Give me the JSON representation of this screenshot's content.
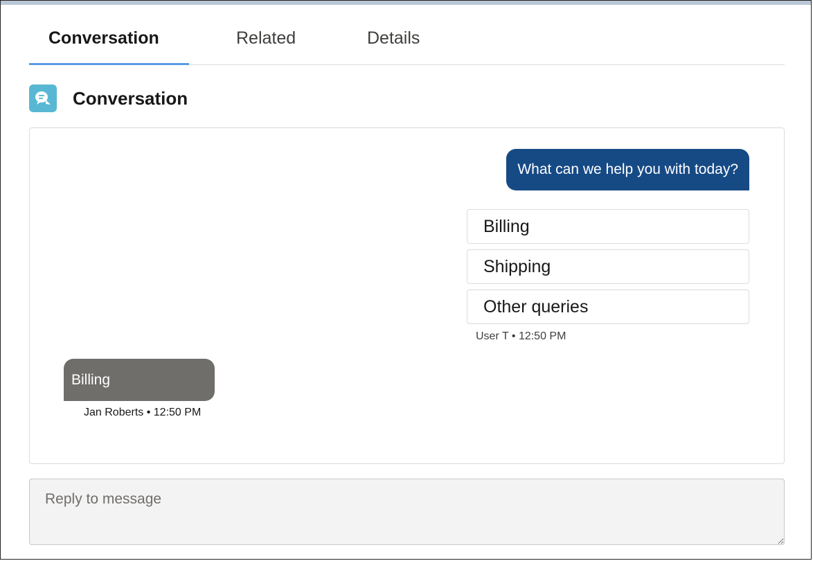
{
  "tabs": [
    {
      "label": "Conversation",
      "active": true
    },
    {
      "label": "Related",
      "active": false
    },
    {
      "label": "Details",
      "active": false
    }
  ],
  "section": {
    "title": "Conversation",
    "icon": "chat-bubble-icon"
  },
  "messages": {
    "outgoing": {
      "text": "What can we help you with today?",
      "options": [
        "Billing",
        "Shipping",
        "Other queries"
      ],
      "sender": "User T",
      "separator": "•",
      "time": "12:50 PM"
    },
    "incoming": {
      "text": "Billing",
      "sender": "Jan Roberts",
      "separator": "•",
      "time": "12:50 PM"
    }
  },
  "reply": {
    "placeholder": "Reply to message",
    "value": ""
  },
  "colors": {
    "outgoing_bubble": "#164a85",
    "incoming_bubble": "#706e6b",
    "tab_active_underline": "#5a9be6",
    "icon_background": "#58b8d4"
  }
}
